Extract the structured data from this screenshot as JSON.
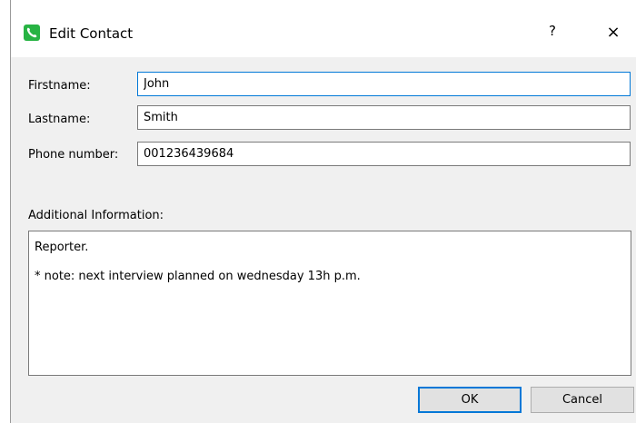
{
  "window": {
    "title": "Edit Contact",
    "icon": "phone-icon",
    "accent_color": "#27b343",
    "help_label": "?",
    "close_label": "×"
  },
  "form": {
    "firstname_label": "Firstname:",
    "firstname_value": "John",
    "lastname_label": "Lastname:",
    "lastname_value": "Smith",
    "phone_label": "Phone number:",
    "phone_value": "001236439684",
    "additional_label": "Additional Information:",
    "notes_lines": [
      "Reporter.",
      "* note: next interview planned on wednesday 13h p.m."
    ]
  },
  "buttons": {
    "ok": "OK",
    "cancel": "Cancel"
  }
}
